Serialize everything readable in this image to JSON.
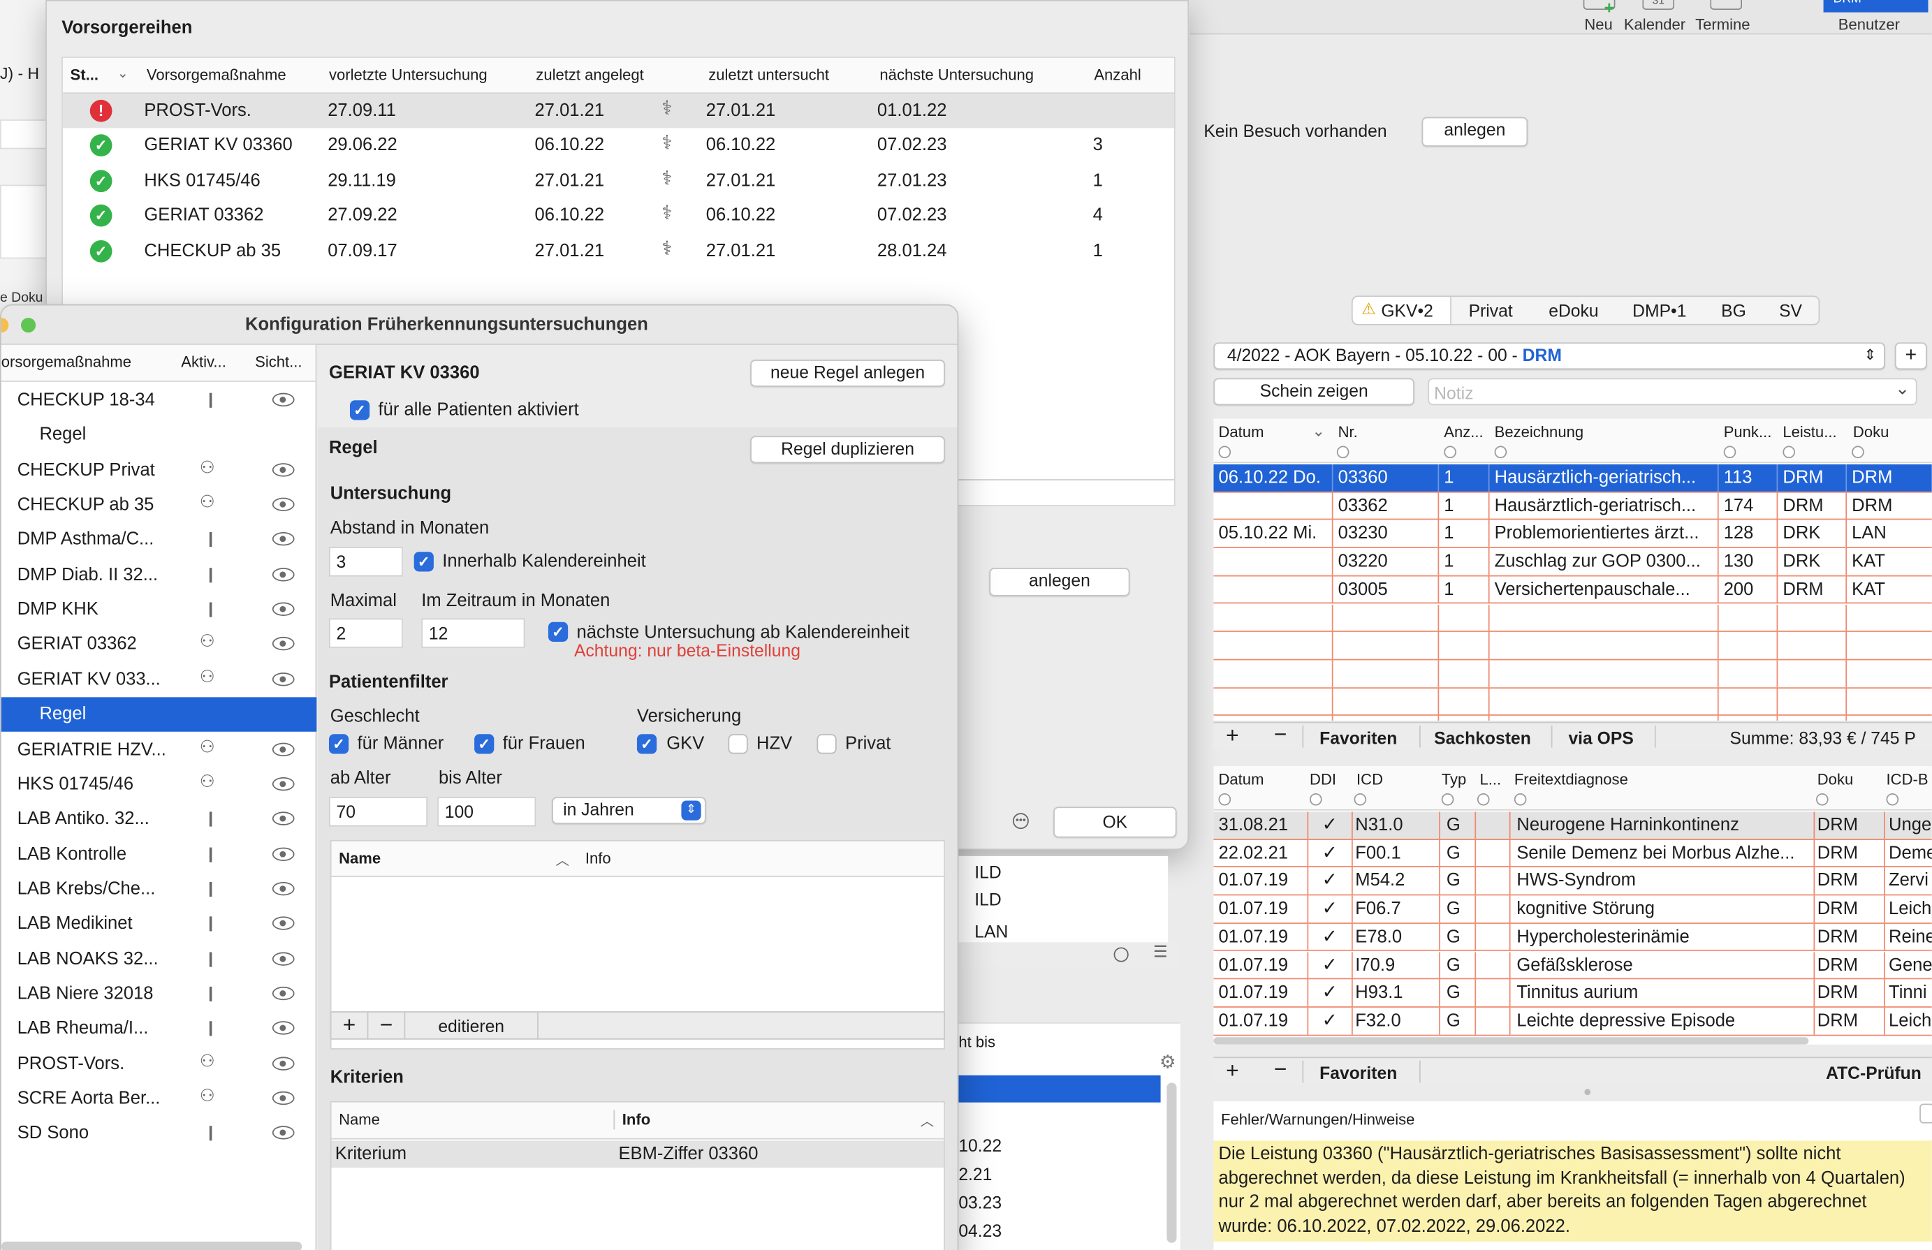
{
  "toolbar": {
    "neu": "Neu",
    "kalender": "Kalender",
    "termine": "Termine",
    "benutzer": "Benutzer",
    "benutzer_badge": "DRM"
  },
  "visit": {
    "label": "Kein Besuch vorhanden",
    "button": "anlegen"
  },
  "vorsorge": {
    "title": "Vorsorgereihen",
    "left_fragment": "J) - H",
    "columns": [
      "St...",
      "Vorsorgemaßnahme",
      "vorletzte Untersuchung",
      "zuletzt angelegt",
      "zuletzt untersucht",
      "nächste Untersuchung",
      "Anzahl"
    ],
    "rows": [
      {
        "status": "error",
        "name": "PROST-Vors.",
        "vorletzte": "27.09.11",
        "angelegt": "27.01.21",
        "untersucht": "27.01.21",
        "naechste": "01.01.22",
        "anzahl": ""
      },
      {
        "status": "ok",
        "name": "GERIAT KV 03360",
        "vorletzte": "29.06.22",
        "angelegt": "06.10.22",
        "untersucht": "06.10.22",
        "naechste": "07.02.23",
        "anzahl": "3"
      },
      {
        "status": "ok",
        "name": "HKS 01745/46",
        "vorletzte": "29.11.19",
        "angelegt": "27.01.21",
        "untersucht": "27.01.21",
        "naechste": "27.01.23",
        "anzahl": "1"
      },
      {
        "status": "ok",
        "name": "GERIAT 03362",
        "vorletzte": "27.09.22",
        "angelegt": "06.10.22",
        "untersucht": "06.10.22",
        "naechste": "07.02.23",
        "anzahl": "4"
      },
      {
        "status": "ok",
        "name": "CHECKUP ab 35",
        "vorletzte": "07.09.17",
        "angelegt": "27.01.21",
        "untersucht": "27.01.21",
        "naechste": "28.01.24",
        "anzahl": "1"
      }
    ],
    "anlegen": "anlegen",
    "ok": "OK"
  },
  "behind": {
    "doku_fragment": "e Doku",
    "ild1": "ILD",
    "ild2": "ILD",
    "lan": "LAN",
    "nicht_bis": "ht bis",
    "dates": [
      "10.22",
      "2.21",
      "03.23",
      "04.23"
    ]
  },
  "config": {
    "title": "Konfiguration Früherkennungsuntersuchungen",
    "list_cols": [
      "orsorgemaßnahme",
      "Aktiv...",
      "Sicht..."
    ],
    "items": [
      {
        "label": "CHECKUP 18-34",
        "icon": "single",
        "eye": true,
        "indent": false
      },
      {
        "label": "Regel",
        "icon": "",
        "eye": false,
        "indent": true
      },
      {
        "label": "CHECKUP Privat",
        "icon": "tree",
        "eye": true,
        "indent": false
      },
      {
        "label": "CHECKUP ab 35",
        "icon": "tree",
        "eye": true,
        "indent": false
      },
      {
        "label": "DMP Asthma/C...",
        "icon": "single",
        "eye": true,
        "indent": false
      },
      {
        "label": "DMP Diab. II 32...",
        "icon": "single",
        "eye": true,
        "indent": false
      },
      {
        "label": "DMP KHK",
        "icon": "single",
        "eye": true,
        "indent": false
      },
      {
        "label": "GERIAT 03362",
        "icon": "tree",
        "eye": true,
        "indent": false
      },
      {
        "label": "GERIAT KV 033...",
        "icon": "tree",
        "eye": true,
        "indent": false
      },
      {
        "label": "Regel",
        "icon": "",
        "eye": false,
        "indent": true,
        "selected": true
      },
      {
        "label": "GERIATRIE HZV...",
        "icon": "tree",
        "eye": true,
        "indent": false
      },
      {
        "label": "HKS 01745/46",
        "icon": "tree",
        "eye": true,
        "indent": false
      },
      {
        "label": "LAB Antiko. 32...",
        "icon": "single",
        "eye": true,
        "indent": false
      },
      {
        "label": "LAB Kontrolle",
        "icon": "single",
        "eye": true,
        "indent": false
      },
      {
        "label": "LAB Krebs/Che...",
        "icon": "single",
        "eye": true,
        "indent": false
      },
      {
        "label": "LAB Medikinet",
        "icon": "single",
        "eye": true,
        "indent": false
      },
      {
        "label": "LAB NOAKS 32...",
        "icon": "single",
        "eye": true,
        "indent": false
      },
      {
        "label": "LAB Niere 32018",
        "icon": "single",
        "eye": true,
        "indent": false
      },
      {
        "label": "LAB Rheuma/I...",
        "icon": "single",
        "eye": true,
        "indent": false
      },
      {
        "label": "PROST-Vors.",
        "icon": "tree",
        "eye": true,
        "indent": false
      },
      {
        "label": "SCRE Aorta Ber...",
        "icon": "tree",
        "eye": true,
        "indent": false
      },
      {
        "label": "SD Sono",
        "icon": "single",
        "eye": true,
        "indent": false
      }
    ],
    "heading": "GERIAT KV 03360",
    "neue_regel": "neue Regel anlegen",
    "alle_aktiviert": "für alle Patienten aktiviert",
    "regel": "Regel",
    "duplizieren": "Regel duplizieren",
    "untersuchung": "Untersuchung",
    "abstand": "Abstand in Monaten",
    "abstand_val": "3",
    "innerhalb": "Innerhalb Kalendereinheit",
    "maximal": "Maximal",
    "maximal_val": "2",
    "zeitraum": "Im Zeitraum in Monaten",
    "zeitraum_val": "12",
    "naechste": "nächste Untersuchung ab Kalendereinheit",
    "warning": "Achtung: nur beta-Einstellung",
    "patientenfilter": "Patientenfilter",
    "geschlecht": "Geschlecht",
    "maenner": "für Männer",
    "frauen": "für Frauen",
    "versicherung": "Versicherung",
    "gkv": "GKV",
    "hzv": "HZV",
    "privat": "Privat",
    "ab_alter": "ab Alter",
    "ab_val": "70",
    "bis_alter": "bis Alter",
    "bis_val": "100",
    "einheit": "in Jahren",
    "name_col": "Name",
    "info_col": "Info",
    "editieren": "editieren",
    "kriterien": "Kriterien",
    "krit_row": {
      "name": "Kriterium",
      "info": "EBM-Ziffer 03360"
    }
  },
  "right": {
    "tabs": [
      "GKV•2",
      "Privat",
      "eDoku",
      "DMP•1",
      "BG",
      "SV"
    ],
    "quarter": "4/2022 - AOK Bayern - 05.10.22 - 00 - ",
    "quarter_doc": "DRM",
    "schein": "Schein zeigen",
    "notiz": "Notiz",
    "leist_cols": [
      "Datum",
      "Nr.",
      "Anz...",
      "Bezeichnung",
      "Punk...",
      "Leistu...",
      "Doku"
    ],
    "leist_rows": [
      {
        "datum": "06.10.22  Do.",
        "nr": "03360",
        "anz": "1",
        "bez": "Hausärztlich-geriatrisch...",
        "punkte": "113",
        "leist": "DRM",
        "doku": "DRM",
        "sel": true
      },
      {
        "datum": "",
        "nr": "03362",
        "anz": "1",
        "bez": "Hausärztlich-geriatrisch...",
        "punkte": "174",
        "leist": "DRM",
        "doku": "DRM"
      },
      {
        "datum": "05.10.22  Mi.",
        "nr": "03230",
        "anz": "1",
        "bez": "Problemorientiertes ärzt...",
        "punkte": "128",
        "leist": "DRK",
        "doku": "LAN"
      },
      {
        "datum": "",
        "nr": "03220",
        "anz": "1",
        "bez": "Zuschlag zur GOP 0300...",
        "punkte": "130",
        "leist": "DRK",
        "doku": "KAT"
      },
      {
        "datum": "",
        "nr": "03005",
        "anz": "1",
        "bez": "Versichertenpauschale...",
        "punkte": "200",
        "leist": "DRM",
        "doku": "KAT"
      }
    ],
    "favoriten": "Favoriten",
    "sachkosten": "Sachkosten",
    "via_ops": "via OPS",
    "summe": "Summe: 83,93 € / 745 P",
    "diag_cols": [
      "Datum",
      "DDI",
      "ICD",
      "Typ",
      "L...",
      "Freitextdiagnose",
      "Doku",
      "ICD-B"
    ],
    "diag_rows": [
      {
        "datum": "31.08.21",
        "icd": "N31.0",
        "typ": "G",
        "text": "Neurogene Harninkontinenz",
        "doku": "DRM",
        "icdb": "Unge"
      },
      {
        "datum": "22.02.21",
        "icd": "F00.1",
        "typ": "G",
        "text": "Senile Demenz bei Morbus Alzhe...",
        "doku": "DRM",
        "icdb": "Deme"
      },
      {
        "datum": "01.07.19",
        "icd": "M54.2",
        "typ": "G",
        "text": "HWS-Syndrom",
        "doku": "DRM",
        "icdb": "Zervi"
      },
      {
        "datum": "01.07.19",
        "icd": "F06.7",
        "typ": "G",
        "text": "kognitive Störung",
        "doku": "DRM",
        "icdb": "Leich"
      },
      {
        "datum": "01.07.19",
        "icd": "E78.0",
        "typ": "G",
        "text": "Hypercholesterinämie",
        "doku": "DRM",
        "icdb": "Reine"
      },
      {
        "datum": "01.07.19",
        "icd": "I70.9",
        "typ": "G",
        "text": "Gefäßsklerose",
        "doku": "DRM",
        "icdb": "Gene"
      },
      {
        "datum": "01.07.19",
        "icd": "H93.1",
        "typ": "G",
        "text": "Tinnitus aurium",
        "doku": "DRM",
        "icdb": "Tinni"
      },
      {
        "datum": "01.07.19",
        "icd": "F32.0",
        "typ": "G",
        "text": "Leichte depressive Episode",
        "doku": "DRM",
        "icdb": "Leich"
      }
    ],
    "atc": "ATC-Prüfun",
    "fehler": "Fehler/Warnungen/Hinweise",
    "message": "Die Leistung 03360 (\"Hausärztlich-geriatrisches Basisassessment\") sollte nicht abgerechnet werden, da diese Leistung im Krankheitsfall (= innerhalb von 4 Quartalen) nur 2 mal abgerechnet werden darf, aber bereits an folgenden Tagen abgerechnet wurde: 06.10.2022, 07.02.2022, 29.06.2022."
  },
  "colors": {
    "selection": "#1f63d6",
    "accent": "#2a6cdc",
    "warning_bg": "#fcf2b0",
    "error_red": "#e0303a",
    "ok_green": "#34b34a",
    "beta_red": "#e0403a"
  }
}
